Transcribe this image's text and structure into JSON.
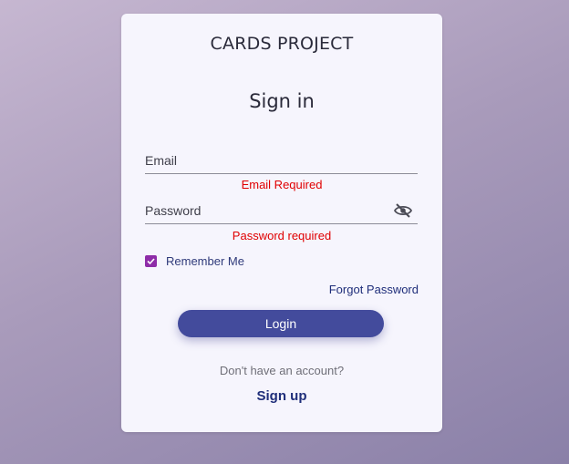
{
  "brand": {
    "title": "CARDS PROJECT"
  },
  "form": {
    "heading": "Sign in",
    "email": {
      "label": "Email",
      "value": "",
      "error": "Email Required"
    },
    "password": {
      "label": "Password",
      "value": "",
      "error": "Password required",
      "visibility_icon": "eye-off-icon"
    },
    "remember": {
      "label": "Remember Me",
      "checked": true
    },
    "forgot_label": "Forgot Password",
    "login_label": "Login",
    "no_account_text": "Don't have an account?",
    "signup_label": "Sign up"
  },
  "colors": {
    "error": "#e00000",
    "accent": "#434b9c",
    "checkbox": "#8e2ca8",
    "link": "#1f2e7a"
  }
}
